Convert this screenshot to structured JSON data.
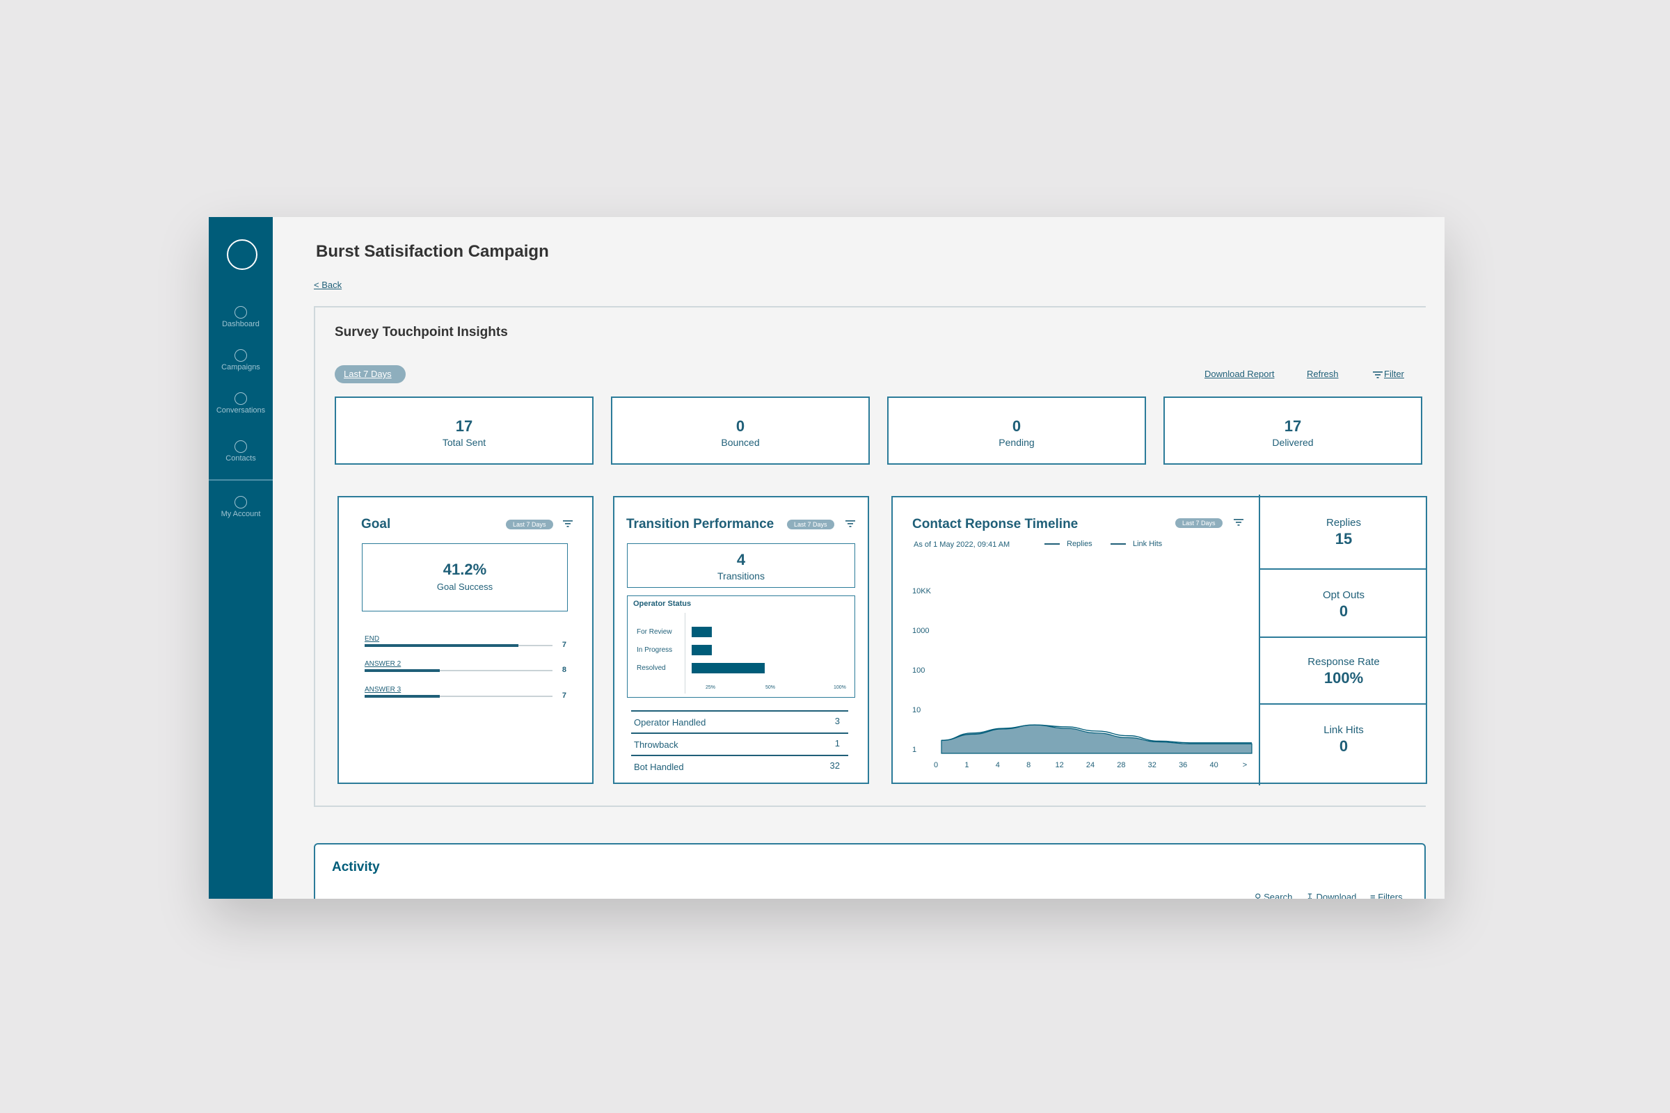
{
  "sidebar": {
    "items": [
      {
        "label": "Dashboard",
        "icon": "circle-icon"
      },
      {
        "label": "Campaigns",
        "icon": "circle-icon"
      },
      {
        "label": "Conversations",
        "icon": "circle-icon"
      },
      {
        "label": "Contacts",
        "icon": "circle-icon"
      },
      {
        "label": "My Account",
        "icon": "circle-icon"
      }
    ]
  },
  "header": {
    "title": "Burst Satisifaction Campaign",
    "back_label": "< Back"
  },
  "insights": {
    "title": "Survey Touchpoint Insights",
    "range_pill": "Last 7 Days",
    "actions": {
      "download": "Download Report",
      "refresh": "Refresh",
      "filter": "Filter"
    },
    "stats": [
      {
        "value": "17",
        "label": "Total Sent"
      },
      {
        "value": "0",
        "label": "Bounced"
      },
      {
        "value": "0",
        "label": "Pending"
      },
      {
        "value": "17",
        "label": "Delivered"
      }
    ]
  },
  "goal": {
    "title": "Goal",
    "pill": "Last 7 Days",
    "value": "41.2%",
    "label": "Goal Success",
    "answers": [
      {
        "label": "END",
        "count": "7",
        "fill": 0.82
      },
      {
        "label": "ANSWER 2",
        "count": "8",
        "fill": 0.4
      },
      {
        "label": "ANSWER 3",
        "count": "7",
        "fill": 0.4
      }
    ]
  },
  "transition": {
    "title": "Transition Performance",
    "pill": "Last 7 Days",
    "value": "4",
    "label": "Transitions",
    "operator_status": {
      "title": "Operator Status",
      "rows": [
        {
          "label": "For Review",
          "fill": 0.14
        },
        {
          "label": "In Progress",
          "fill": 0.14
        },
        {
          "label": "Resolved",
          "fill": 0.5
        }
      ],
      "ticks": [
        "25%",
        "50%",
        "100%"
      ]
    },
    "table": [
      {
        "label": "Operator Handled",
        "value": "3"
      },
      {
        "label": "Throwback",
        "value": "1"
      },
      {
        "label": "Bot Handled",
        "value": "32"
      }
    ]
  },
  "timeline": {
    "title": "Contact Reponse Timeline",
    "pill": "Last 7 Days",
    "as_of": "As of 1 May 2022, 09:41 AM",
    "legend": [
      "Replies",
      "Link Hits"
    ],
    "colors": {
      "area": "#7ea6b7",
      "line": "#005c79"
    }
  },
  "chart_data": {
    "type": "area",
    "title": "Contact Reponse Timeline",
    "x_ticks": [
      "0",
      "1",
      "4",
      "8",
      "12",
      "24",
      "28",
      "32",
      "36",
      "40",
      ">"
    ],
    "y_ticks": [
      "10KK",
      "1000",
      "100",
      "10",
      "1"
    ],
    "y_scale": "log",
    "series": [
      {
        "name": "Replies",
        "values": [
          1,
          3,
          6,
          10,
          6,
          3,
          1.5,
          0.8,
          0.6,
          0.6,
          0.6
        ]
      },
      {
        "name": "Link Hits",
        "values": [
          1,
          2.5,
          5.5,
          10,
          7.5,
          4,
          2,
          0.9,
          0.7,
          0.7,
          0.7
        ]
      }
    ],
    "grid": false
  },
  "metrics": [
    {
      "label": "Replies",
      "value": "15"
    },
    {
      "label": "Opt Outs",
      "value": "0"
    },
    {
      "label": "Response Rate",
      "value": "100%"
    },
    {
      "label": "Link Hits",
      "value": "0"
    }
  ],
  "activity": {
    "title": "Activity",
    "tools": [
      "Search",
      "Download",
      "Filters"
    ]
  }
}
